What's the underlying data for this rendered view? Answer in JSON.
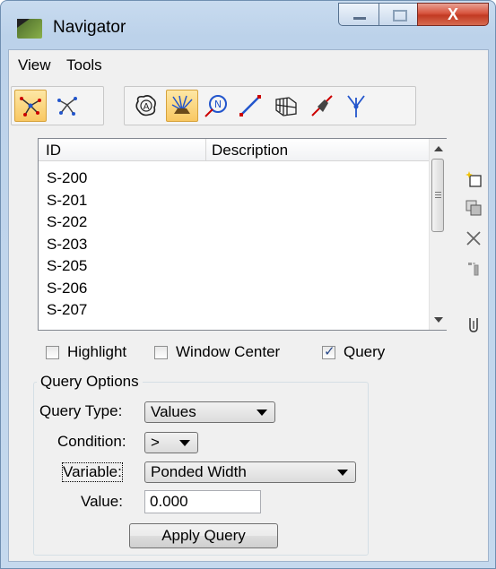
{
  "window": {
    "title": "Navigator",
    "close_glyph": "X",
    "icons": [
      "navigator-app-icon",
      "minimize-icon",
      "maximize-icon",
      "close-icon"
    ]
  },
  "menubar": {
    "items": [
      "View",
      "Tools"
    ]
  },
  "toolbar": {
    "left_icons": [
      "network-active-icon",
      "network-icon"
    ],
    "right_icons": [
      "area-icon",
      "drainage-active-icon",
      "node-icon",
      "link-icon",
      "profile-icon",
      "structure-icon",
      "outlet-icon"
    ]
  },
  "list": {
    "columns": [
      "ID",
      "Description"
    ],
    "rows": [
      {
        "id": "S-200",
        "description": ""
      },
      {
        "id": "S-201",
        "description": ""
      },
      {
        "id": "S-202",
        "description": ""
      },
      {
        "id": "S-203",
        "description": ""
      },
      {
        "id": "S-205",
        "description": ""
      },
      {
        "id": "S-206",
        "description": ""
      },
      {
        "id": "S-207",
        "description": ""
      }
    ]
  },
  "side_tools": [
    "new-icon",
    "copy-icon",
    "delete-icon",
    "move-icon",
    "measure-icon"
  ],
  "options": {
    "highlight": {
      "label": "Highlight",
      "checked": false
    },
    "window_center": {
      "label": "Window Center",
      "checked": false
    },
    "query": {
      "label": "Query",
      "checked": true
    }
  },
  "query_options": {
    "title": "Query Options",
    "query_type_label": "Query Type:",
    "query_type_value": "Values",
    "condition_label": "Condition:",
    "condition_value": ">",
    "variable_label": "Variable:",
    "variable_value": "Ponded Width",
    "value_label": "Value:",
    "value_value": "0.000",
    "apply_label": "Apply Query"
  },
  "colors": {
    "accent": "#f9c862",
    "frame": "#c5d9ee",
    "close": "#c23a23"
  }
}
